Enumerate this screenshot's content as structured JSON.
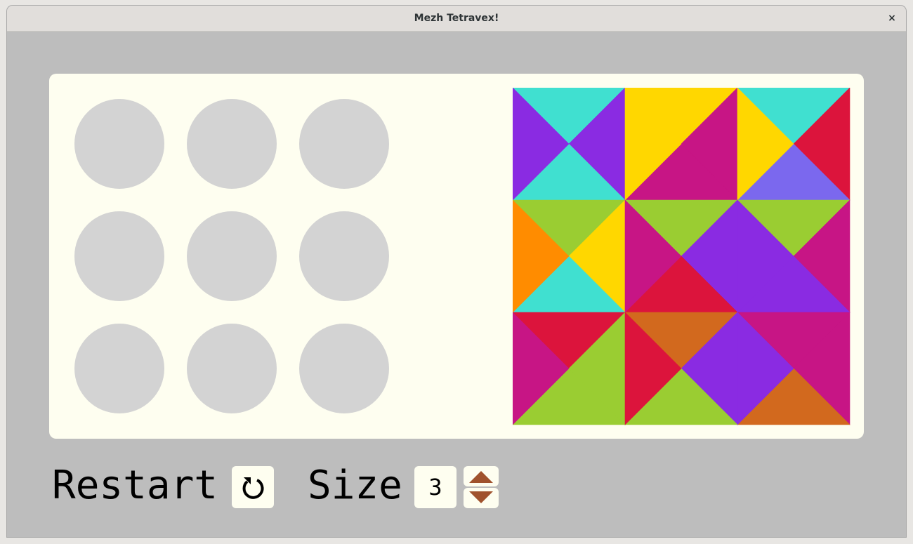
{
  "window": {
    "title": "Mezh Tetravex!",
    "close_glyph": "×"
  },
  "slots": {
    "count": 9,
    "color": "#d3d3d3"
  },
  "tiles": {
    "grid": 3,
    "colors": {
      "turquoise": "#40e0d0",
      "purple": "#8a2be2",
      "gold": "#ffd700",
      "magenta": "#c71585",
      "crimson": "#dc143c",
      "slateblue": "#7b68ee",
      "yellowgreen": "#9acd32",
      "orange": "#ff8c00",
      "chocolate": "#d2691e"
    },
    "cells": [
      {
        "top": "turquoise",
        "right": "purple",
        "bottom": "turquoise",
        "left": "purple"
      },
      {
        "top": "gold",
        "right": "magenta",
        "bottom": "magenta",
        "left": "gold"
      },
      {
        "top": "turquoise",
        "right": "crimson",
        "bottom": "slateblue",
        "left": "gold"
      },
      {
        "top": "yellowgreen",
        "right": "gold",
        "bottom": "turquoise",
        "left": "orange"
      },
      {
        "top": "yellowgreen",
        "right": "purple",
        "bottom": "crimson",
        "left": "magenta"
      },
      {
        "top": "yellowgreen",
        "right": "magenta",
        "bottom": "purple",
        "left": "purple"
      },
      {
        "top": "crimson",
        "right": "yellowgreen",
        "bottom": "yellowgreen",
        "left": "magenta"
      },
      {
        "top": "chocolate",
        "right": "purple",
        "bottom": "yellowgreen",
        "left": "crimson"
      },
      {
        "top": "magenta",
        "right": "magenta",
        "bottom": "chocolate",
        "left": "purple"
      }
    ]
  },
  "controls": {
    "restart_label": "Restart",
    "restart_icon": "undo-icon",
    "size_label": "Size",
    "size_value": "3",
    "size_up_icon": "triangle-up-icon",
    "size_down_icon": "triangle-down-icon",
    "arrow_color": "#a0522d"
  }
}
